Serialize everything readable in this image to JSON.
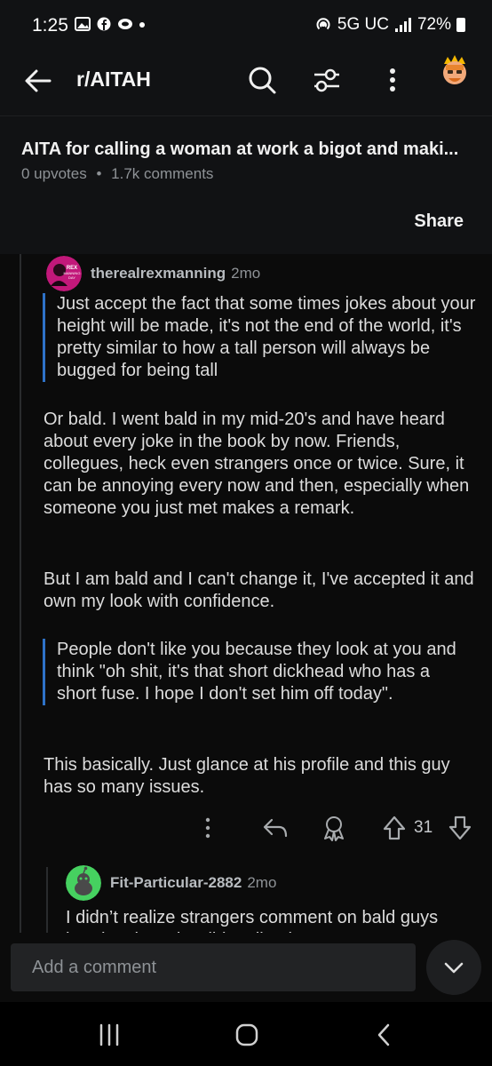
{
  "status_bar": {
    "time": "1:25",
    "network": "5G UC",
    "battery": "72%"
  },
  "header": {
    "subreddit": "r/AITAH",
    "icons": [
      "back-arrow-icon",
      "search-icon",
      "filter-icon",
      "more-vertical-icon",
      "avatar-icon"
    ]
  },
  "post": {
    "title": "AITA for calling a woman at work a bigot and maki...",
    "upvotes": "0 upvotes",
    "separator": "•",
    "comments": "1.7k comments",
    "share_label": "Share"
  },
  "comment": {
    "author": "therealrexmanning",
    "time": "2mo",
    "avatar_text": "REX MANNING DAY",
    "quote1": "Just accept the fact that some times jokes about your height will be made, it's not the end of the world, it's pretty similar to how a tall person will always be bugged for being tall",
    "para1": "Or bald. I went bald in my mid-20's and have heard about every joke in the book by now. Friends, collegues, heck even strangers once or twice. Sure, it can be annoying every now and then, especially when someone you just met makes a remark.",
    "para2": "But I am bald and I can't change it, I've accepted it and own my look with confidence.",
    "quote2": "People don't like you because they look at you and think \"oh shit, it's that short dickhead who has a short fuse. I hope I don't set him off today\".",
    "para3": "This basically. Just glance at his profile and this guy has so many issues.",
    "votes": "31"
  },
  "reply": {
    "author": "Fit-Particular-2882",
    "time": "2mo",
    "text": "I didn’t realize strangers comment on bald guys heads. That’s horrible. Like, have"
  },
  "composer": {
    "placeholder": "Add a comment"
  },
  "colors": {
    "background": "#0b0b0b",
    "surface": "#111214",
    "quote_bar": "#2e72c8",
    "reply_avatar": "#46d160"
  }
}
